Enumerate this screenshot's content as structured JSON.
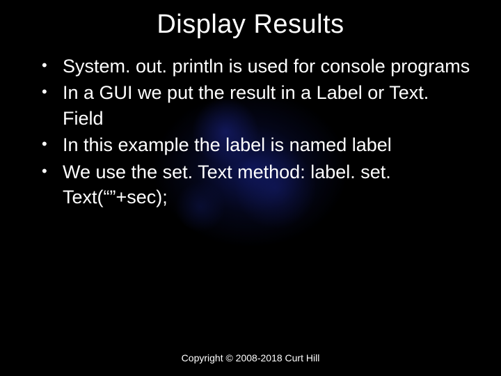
{
  "slide": {
    "title": "Display Results",
    "bullets": [
      "System. out. println is used for console programs",
      "In a GUI we put the result in a Label or Text. Field",
      "In this example the label is named label",
      "We use the set. Text method: label. set. Text(“”+sec);"
    ],
    "copyright": "Copyright © 2008-2018 Curt Hill"
  }
}
